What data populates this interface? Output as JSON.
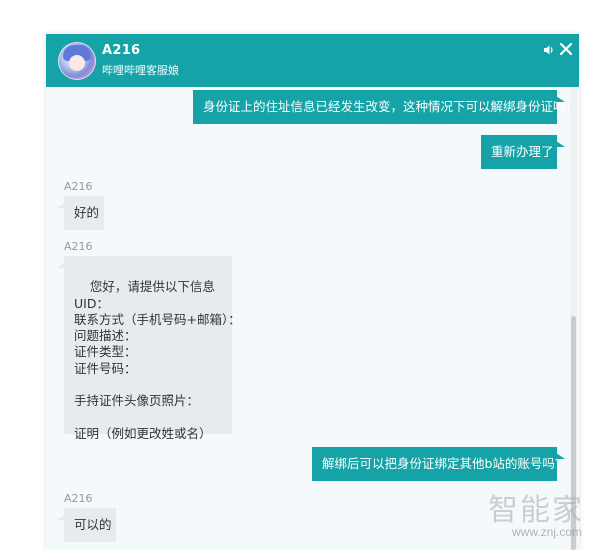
{
  "header": {
    "name": "A216",
    "subtitle": "哔哩哔哩客服娘",
    "sound_icon": "speaker-icon",
    "close_icon": "close-icon"
  },
  "colors": {
    "accent": "#15a3a8",
    "agent_bubble": "#e7ebed",
    "chat_bg": "#f4f9fb"
  },
  "messages": [
    {
      "from": "user",
      "text": "身份证上的住址信息已经发生改变，这种情况下可以解绑身份证吗？"
    },
    {
      "from": "user",
      "text": "重新办理了"
    },
    {
      "from": "agent",
      "sender": "A216",
      "text": "好的"
    },
    {
      "from": "agent",
      "sender": "A216",
      "text": "您好，请提供以下信息\nUID：\n联系方式（手机号码+邮箱）：\n问题描述：\n证件类型：\n证件号码：\n\n手持证件头像页照片：\n\n证明（例如更改姓或名）"
    },
    {
      "from": "user",
      "text": "解绑后可以把身份证绑定其他b站的账号吗？"
    },
    {
      "from": "agent",
      "sender": "A216",
      "text": "可以的"
    }
  ],
  "watermark": {
    "text": "智能家",
    "url": "www.znj.com"
  }
}
